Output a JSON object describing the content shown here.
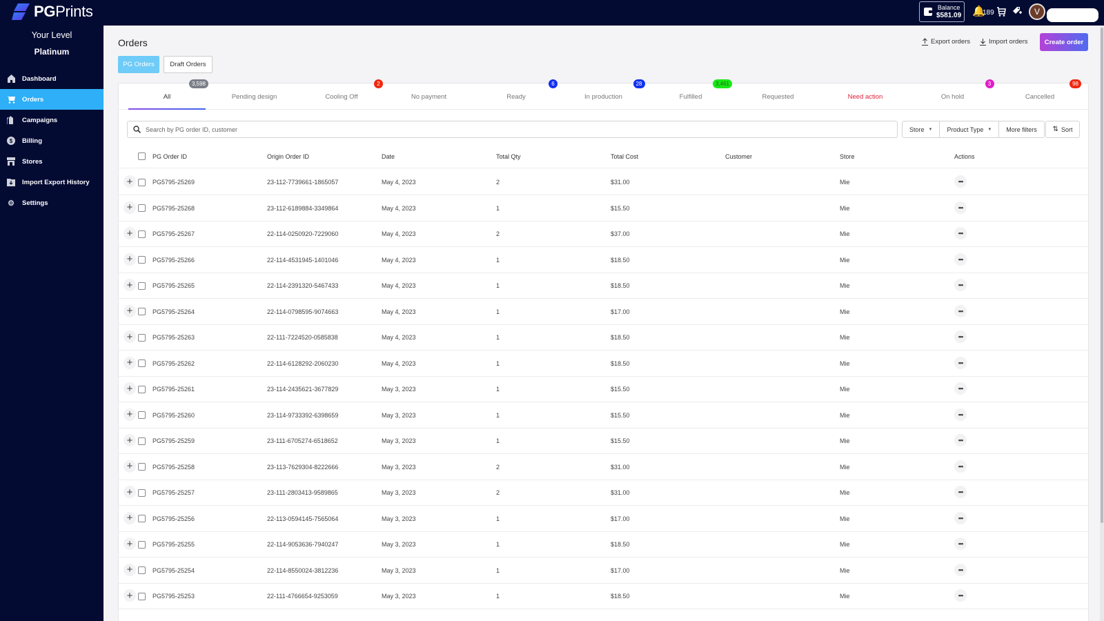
{
  "brand": {
    "name_bold": "PG",
    "name_light": "Prints"
  },
  "topbar": {
    "balance_label": "Balance",
    "balance_value": "$581.09",
    "notifications_count": "189",
    "avatar_initial": "V"
  },
  "sidebar": {
    "level_label": "Your Level",
    "level_value": "Platinum",
    "items": [
      {
        "label": "Dashboard",
        "icon": "home-icon"
      },
      {
        "label": "Orders",
        "icon": "cart-icon",
        "active": true
      },
      {
        "label": "Campaigns",
        "icon": "tag-icon"
      },
      {
        "label": "Billing",
        "icon": "dollar-icon"
      },
      {
        "label": "Stores",
        "icon": "store-icon"
      },
      {
        "label": "Import Export History",
        "icon": "folder-download-icon"
      },
      {
        "label": "Settings",
        "icon": "gear-icon"
      }
    ]
  },
  "page": {
    "title": "Orders",
    "subtabs": [
      "PG Orders",
      "Draft Orders"
    ],
    "export_label": "Export orders",
    "import_label": "Import orders",
    "create_label": "Create order"
  },
  "status_tabs": [
    {
      "label": "All",
      "badge": "3,598",
      "badge_color": "#7a7f87"
    },
    {
      "label": "Pending design",
      "badge": null
    },
    {
      "label": "Cooling Off",
      "badge": "2",
      "badge_color": "#f0280f"
    },
    {
      "label": "No payment",
      "badge": null
    },
    {
      "label": "Ready",
      "badge": "6",
      "badge_color": "#1230f0"
    },
    {
      "label": "In production",
      "badge": "28",
      "badge_color": "#1230f0"
    },
    {
      "label": "Fulfilled",
      "badge": "3,461",
      "badge_color": "#18e818"
    },
    {
      "label": "Requested",
      "badge": null
    },
    {
      "label": "Need action",
      "badge": null
    },
    {
      "label": "On hold",
      "badge": "3",
      "badge_color": "#e21bc9"
    },
    {
      "label": "Cancelled",
      "badge": "98",
      "badge_color": "#f0280f"
    }
  ],
  "search": {
    "placeholder": "Search by PG order ID, customer",
    "value": ""
  },
  "filters": {
    "store": "Store",
    "product_type": "Product Type",
    "more": "More filters",
    "sort": "Sort"
  },
  "table": {
    "columns": [
      "PG Order ID",
      "Origin Order ID",
      "Date",
      "Total Qty",
      "Total Cost",
      "Customer",
      "Store",
      "Actions"
    ],
    "rows": [
      {
        "id": "PG5795-25269",
        "origin": "23-112-7739661-1865057",
        "date": "May 4, 2023",
        "qty": "2",
        "cost": "$31.00",
        "customer": "",
        "store": "Mie"
      },
      {
        "id": "PG5795-25268",
        "origin": "23-112-6189884-3349864",
        "date": "May 4, 2023",
        "qty": "1",
        "cost": "$15.50",
        "customer": "",
        "store": "Mie"
      },
      {
        "id": "PG5795-25267",
        "origin": "22-114-0250920-7229060",
        "date": "May 4, 2023",
        "qty": "2",
        "cost": "$37.00",
        "customer": "",
        "store": "Mie"
      },
      {
        "id": "PG5795-25266",
        "origin": "22-114-4531945-1401046",
        "date": "May 4, 2023",
        "qty": "1",
        "cost": "$18.50",
        "customer": "",
        "store": "Mie"
      },
      {
        "id": "PG5795-25265",
        "origin": "22-114-2391320-5467433",
        "date": "May 4, 2023",
        "qty": "1",
        "cost": "$18.50",
        "customer": "",
        "store": "Mie"
      },
      {
        "id": "PG5795-25264",
        "origin": "22-114-0798595-9074663",
        "date": "May 4, 2023",
        "qty": "1",
        "cost": "$17.00",
        "customer": "",
        "store": "Mie"
      },
      {
        "id": "PG5795-25263",
        "origin": "22-111-7224520-0585838",
        "date": "May 4, 2023",
        "qty": "1",
        "cost": "$18.50",
        "customer": "",
        "store": "Mie"
      },
      {
        "id": "PG5795-25262",
        "origin": "22-114-6128292-2060230",
        "date": "May 4, 2023",
        "qty": "1",
        "cost": "$18.50",
        "customer": "",
        "store": "Mie"
      },
      {
        "id": "PG5795-25261",
        "origin": "23-114-2435621-3677829",
        "date": "May 3, 2023",
        "qty": "1",
        "cost": "$15.50",
        "customer": "",
        "store": "Mie"
      },
      {
        "id": "PG5795-25260",
        "origin": "23-114-9733392-6398659",
        "date": "May 3, 2023",
        "qty": "1",
        "cost": "$15.50",
        "customer": "",
        "store": "Mie"
      },
      {
        "id": "PG5795-25259",
        "origin": "23-111-6705274-6518652",
        "date": "May 3, 2023",
        "qty": "1",
        "cost": "$15.50",
        "customer": "",
        "store": "Mie"
      },
      {
        "id": "PG5795-25258",
        "origin": "23-113-7629304-8222666",
        "date": "May 3, 2023",
        "qty": "2",
        "cost": "$31.00",
        "customer": "",
        "store": "Mie"
      },
      {
        "id": "PG5795-25257",
        "origin": "23-111-2803413-9589865",
        "date": "May 3, 2023",
        "qty": "2",
        "cost": "$31.00",
        "customer": "",
        "store": "Mie"
      },
      {
        "id": "PG5795-25256",
        "origin": "22-113-0594145-7565064",
        "date": "May 3, 2023",
        "qty": "1",
        "cost": "$17.00",
        "customer": "",
        "store": "Mie"
      },
      {
        "id": "PG5795-25255",
        "origin": "22-114-9053636-7940247",
        "date": "May 3, 2023",
        "qty": "1",
        "cost": "$18.50",
        "customer": "",
        "store": "Mie"
      },
      {
        "id": "PG5795-25254",
        "origin": "22-114-8550024-3812236",
        "date": "May 3, 2023",
        "qty": "1",
        "cost": "$17.00",
        "customer": "",
        "store": "Mie"
      },
      {
        "id": "PG5795-25253",
        "origin": "22-111-4766654-9253059",
        "date": "May 3, 2023",
        "qty": "1",
        "cost": "$18.50",
        "customer": "",
        "store": "Mie"
      }
    ]
  }
}
